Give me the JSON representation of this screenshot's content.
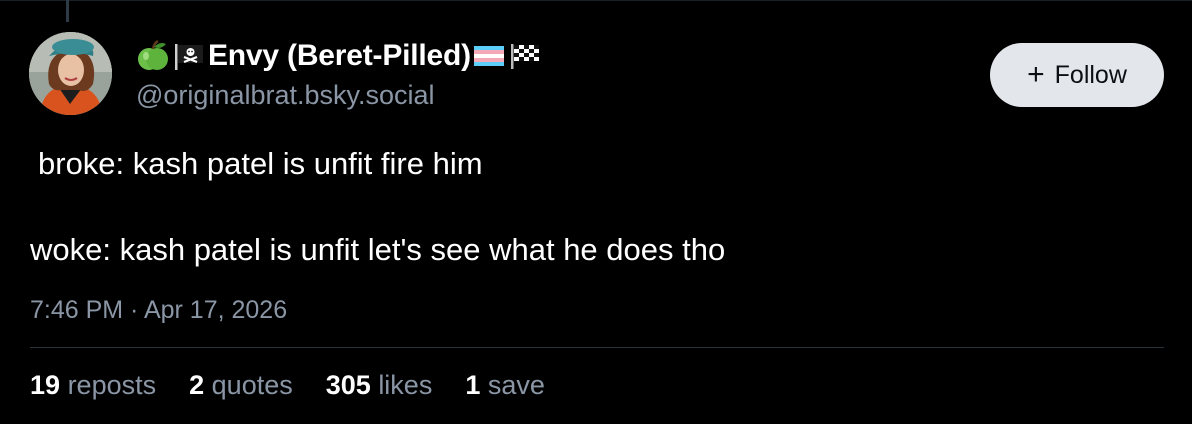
{
  "post": {
    "author": {
      "leading_emojis": [
        "green-apple",
        "pirate-flag"
      ],
      "display_name": "Envy (Beret-Pilled)",
      "trailing_emojis": [
        "transgender-flag",
        "checkered-flag"
      ],
      "handle": "@originalbrat.bsky.social"
    },
    "follow_button": {
      "icon": "+",
      "label": "Follow"
    },
    "text_lines": [
      "broke: kash patel is unfit fire him",
      "woke: kash patel is unfit let's see what he does tho"
    ],
    "timestamp": "7:46 PM · Apr 17, 2026",
    "stats": [
      {
        "count": "19",
        "label": "reposts"
      },
      {
        "count": "2",
        "label": "quotes"
      },
      {
        "count": "305",
        "label": "likes"
      },
      {
        "count": "1",
        "label": "save"
      }
    ]
  },
  "colors": {
    "background": "#000000",
    "text": "#ffffff",
    "muted": "#8a96a5",
    "button_bg": "#e3e7ec",
    "button_text": "#0b1015",
    "divider": "#2a333c"
  }
}
